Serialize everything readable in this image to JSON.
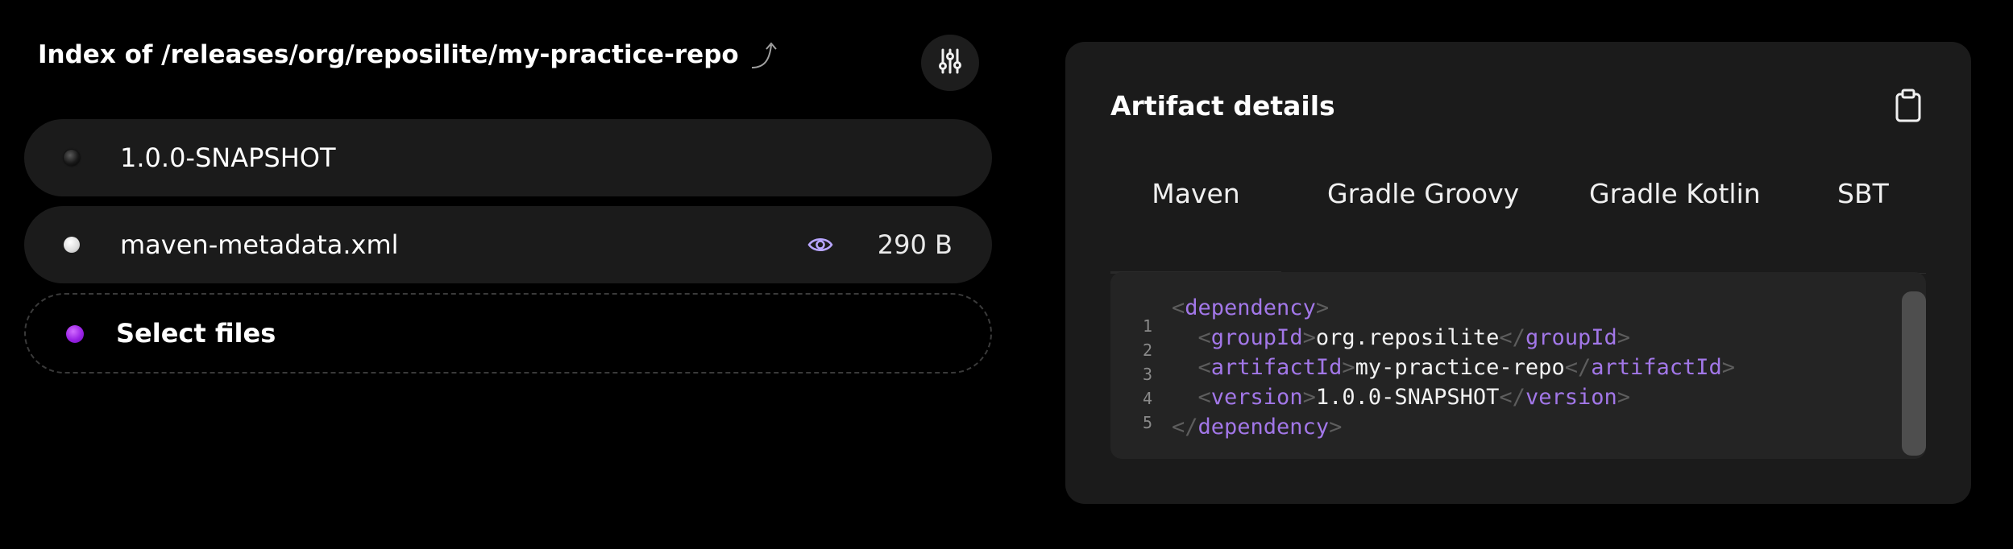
{
  "header": {
    "title": "Index of /releases/org/reposilite/my-practice-repo",
    "up_icon": "arrow-up-curve-icon",
    "settings_icon": "sliders-icon"
  },
  "files": [
    {
      "name": "1.0.0-SNAPSHOT",
      "type": "directory",
      "dot_color": "#1a1a1a"
    },
    {
      "name": "maven-metadata.xml",
      "type": "file",
      "size": "290 B",
      "dot_color": "#e5e5e5",
      "preview_icon": "eye-icon"
    }
  ],
  "upload": {
    "label": "Select files",
    "dot_color": "#a22fef"
  },
  "artifact": {
    "title": "Artifact details",
    "copy_icon": "clipboard-icon",
    "tabs": [
      "Maven",
      "Gradle Groovy",
      "Gradle Kotlin",
      "SBT"
    ],
    "active_tab": "Maven",
    "line_numbers": [
      "1",
      "2",
      "3",
      "4",
      "5"
    ],
    "code": {
      "root_tag": "dependency",
      "fields": [
        {
          "tag": "groupId",
          "value": "org.reposilite"
        },
        {
          "tag": "artifactId",
          "value": "my-practice-repo"
        },
        {
          "tag": "version",
          "value": "1.0.0-SNAPSHOT"
        }
      ]
    }
  },
  "colors": {
    "background": "#000000",
    "card": "#1b1b1b",
    "code_bg": "#242424",
    "accent_tag": "#a277e8",
    "accent_eye": "#b8a6ff",
    "upload_dot": "#a22fef"
  }
}
